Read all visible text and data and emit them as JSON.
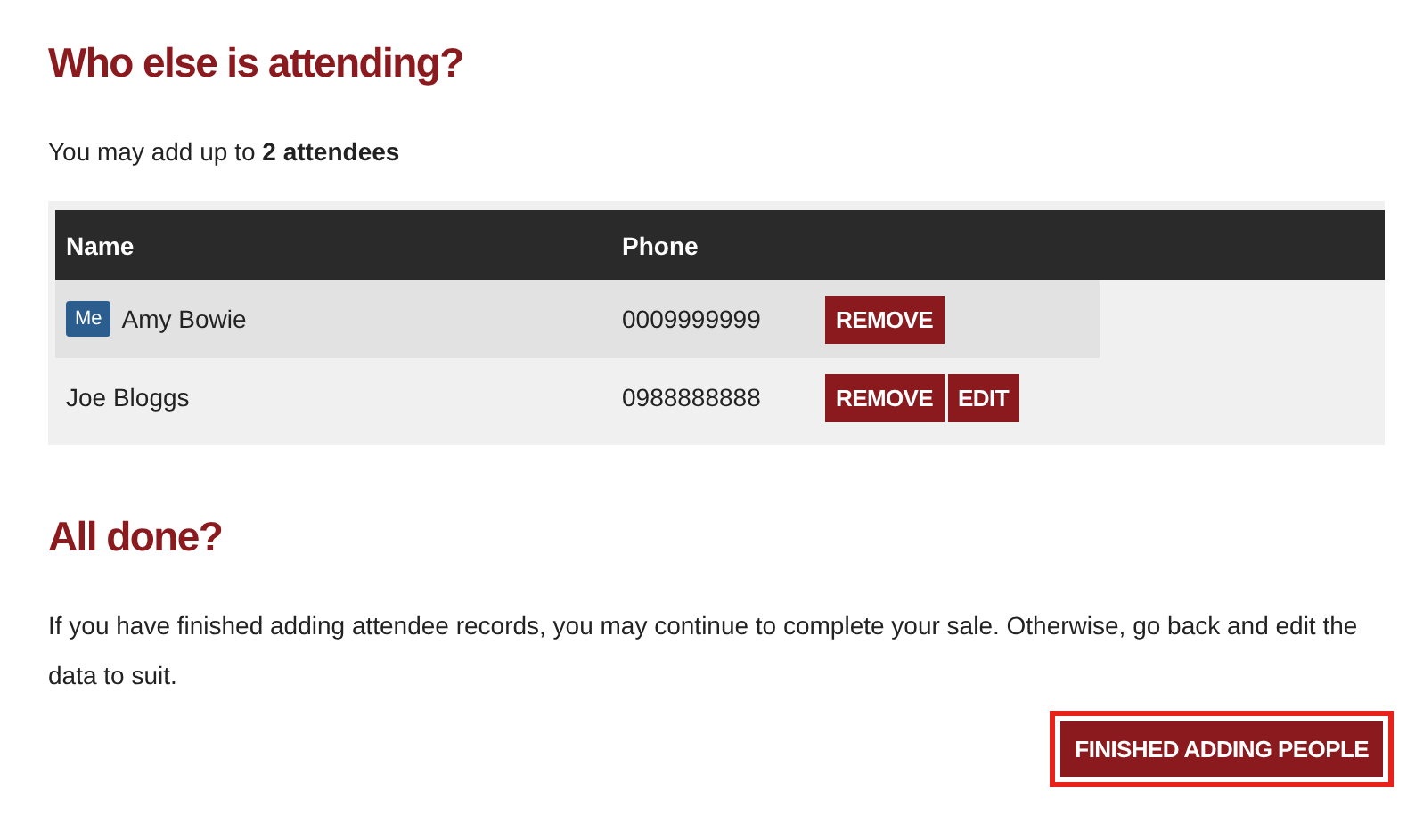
{
  "attending": {
    "title": "Who else is attending?",
    "note": "You may add up to **2 attendees**",
    "columns": [
      "Name",
      "Phone"
    ],
    "rows": [
      {
        "badge": "Me",
        "name": "Amy Bowie",
        "phone": "0009999999",
        "highlighted": true,
        "actions": [
          "REMOVE"
        ]
      },
      {
        "name": "Joe Bloggs",
        "phone": "0988888888",
        "highlighted": false,
        "actions": [
          "REMOVE",
          "EDIT"
        ]
      }
    ]
  },
  "done": {
    "title": "All done?",
    "text": "If you have finished adding attendee records, you may continue to complete your sale. Otherwise, go back and edit the data to suit.",
    "button": {
      "label": "FINISHED ADDING PEOPLE",
      "focused": true
    }
  }
}
